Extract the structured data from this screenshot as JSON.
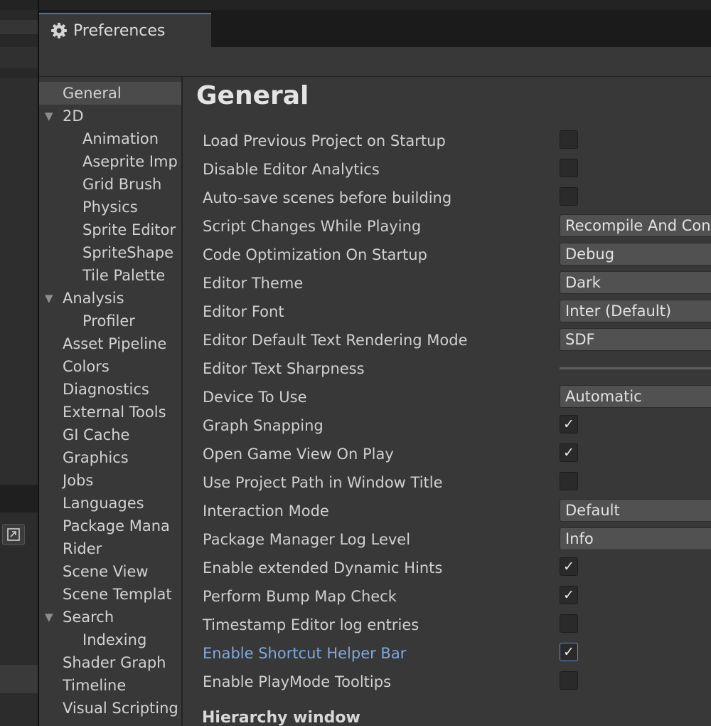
{
  "window": {
    "tab_title": "Preferences"
  },
  "sidebar": {
    "items": [
      {
        "label": "General",
        "selected": true
      },
      {
        "label": "2D",
        "expanded": true
      },
      {
        "label": "Animation"
      },
      {
        "label": "Aseprite Imp"
      },
      {
        "label": "Grid Brush"
      },
      {
        "label": "Physics"
      },
      {
        "label": "Sprite Editor"
      },
      {
        "label": "SpriteShape"
      },
      {
        "label": "Tile Palette"
      },
      {
        "label": "Analysis",
        "expanded": true
      },
      {
        "label": "Profiler"
      },
      {
        "label": "Asset Pipeline"
      },
      {
        "label": "Colors"
      },
      {
        "label": "Diagnostics"
      },
      {
        "label": "External Tools"
      },
      {
        "label": "GI Cache"
      },
      {
        "label": "Graphics"
      },
      {
        "label": "Jobs"
      },
      {
        "label": "Languages"
      },
      {
        "label": "Package Mana"
      },
      {
        "label": "Rider"
      },
      {
        "label": "Scene View"
      },
      {
        "label": "Scene Templat"
      },
      {
        "label": "Search",
        "expanded": true
      },
      {
        "label": "Indexing"
      },
      {
        "label": "Shader Graph"
      },
      {
        "label": "Timeline"
      },
      {
        "label": "Visual Scripting"
      }
    ]
  },
  "main": {
    "title": "General",
    "settings": [
      {
        "label": "Load Previous Project on Startup",
        "type": "checkbox",
        "checked": false
      },
      {
        "label": "Disable Editor Analytics",
        "type": "checkbox",
        "checked": false
      },
      {
        "label": "Auto-save scenes before building",
        "type": "checkbox",
        "checked": false
      },
      {
        "label": "Script Changes While Playing",
        "type": "dropdown",
        "value": "Recompile And Continue Playing"
      },
      {
        "label": "Code Optimization On Startup",
        "type": "dropdown",
        "value": "Debug"
      },
      {
        "label": "Editor Theme",
        "type": "dropdown",
        "value": "Dark"
      },
      {
        "label": "Editor Font",
        "type": "dropdown",
        "value": "Inter (Default)"
      },
      {
        "label": "Editor Default Text Rendering Mode",
        "type": "dropdown",
        "value": "SDF"
      },
      {
        "label": "Editor Text Sharpness",
        "type": "slider"
      },
      {
        "label": "Device To Use",
        "type": "dropdown",
        "value": "Automatic"
      },
      {
        "label": "Graph Snapping",
        "type": "checkbox",
        "checked": true
      },
      {
        "label": "Open Game View On Play",
        "type": "checkbox",
        "checked": true
      },
      {
        "label": "Use Project Path in Window Title",
        "type": "checkbox",
        "checked": false
      },
      {
        "label": "Interaction Mode",
        "type": "dropdown",
        "value": "Default"
      },
      {
        "label": "Package Manager Log Level",
        "type": "dropdown",
        "value": "Info"
      },
      {
        "label": "Enable extended Dynamic Hints",
        "type": "checkbox",
        "checked": true
      },
      {
        "label": "Perform Bump Map Check",
        "type": "checkbox",
        "checked": true
      },
      {
        "label": "Timestamp Editor log entries",
        "type": "checkbox",
        "checked": false
      },
      {
        "label": "Enable Shortcut Helper Bar",
        "type": "checkbox",
        "checked": true,
        "focused": true
      },
      {
        "label": "Enable PlayMode Tooltips",
        "type": "checkbox",
        "checked": false
      }
    ],
    "next_section": "Hierarchy window"
  },
  "icons": {
    "tab_icon": "gear-icon",
    "popout": "popout-icon"
  },
  "colors": {
    "accent": "#3a79bb",
    "highlight_label": "#7fa8de",
    "panel": "#383838"
  }
}
